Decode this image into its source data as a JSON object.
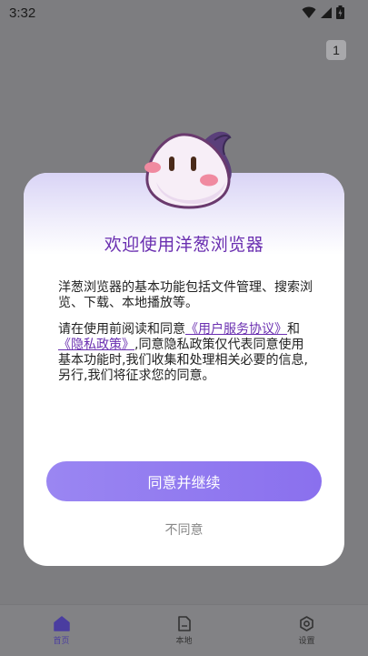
{
  "status": {
    "time": "3:32"
  },
  "tab_count": "1",
  "dialog": {
    "title": "欢迎使用洋葱浏览器",
    "para1": "洋葱浏览器的基本功能包括文件管理、搜索浏览、下载、本地播放等。",
    "para2_before": "请在使用前阅读和同意",
    "link_user_agreement": "《用户服务协议》",
    "para2_and": "和",
    "link_privacy_policy": "《隐私政策》",
    "para2_after": ",同意隐私政策仅代表同意使用基本功能时,我们收集和处理相关必要的信息,另行,我们将征求您的同意。",
    "agree_button": "同意并继续",
    "disagree_button": "不同意"
  },
  "bottom_nav": {
    "items": [
      {
        "label": "首页",
        "icon": "home-icon"
      },
      {
        "label": "本地",
        "icon": "folder-icon"
      },
      {
        "label": "设置",
        "icon": "settings-icon"
      }
    ]
  },
  "colors": {
    "accent": "#6a2fb0",
    "button": "#8f7af0"
  }
}
